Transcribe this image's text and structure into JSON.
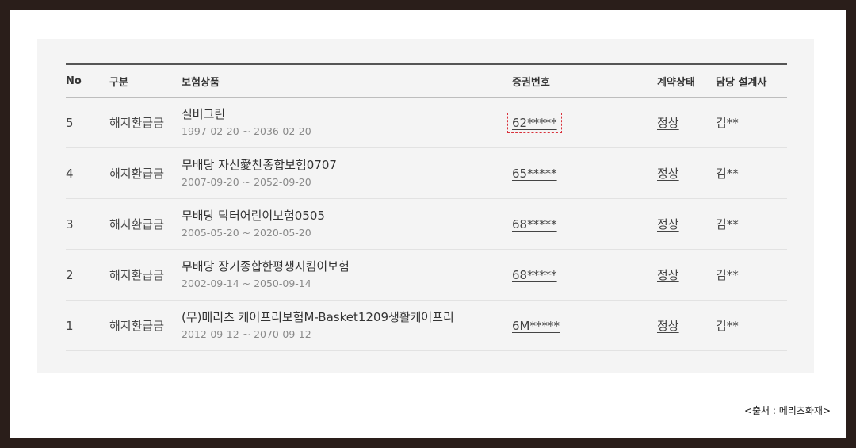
{
  "table": {
    "headers": {
      "no": "No",
      "type": "구분",
      "product": "보험상품",
      "policy_number": "증권번호",
      "status": "계약상태",
      "planner": "담당 설계사"
    },
    "rows": [
      {
        "no": "5",
        "type": "해지환급금",
        "product_name": "실버그린",
        "period": "1997-02-20 ~ 2036-02-20",
        "policy_number": "62*****",
        "status": "정상",
        "planner": "김**",
        "focused": true
      },
      {
        "no": "4",
        "type": "해지환급금",
        "product_name": "무배당 자신愛찬종합보험0707",
        "period": "2007-09-20 ~ 2052-09-20",
        "policy_number": "65*****",
        "status": "정상",
        "planner": "김**",
        "focused": false
      },
      {
        "no": "3",
        "type": "해지환급금",
        "product_name": "무배당 닥터어린이보험0505",
        "period": "2005-05-20 ~ 2020-05-20",
        "policy_number": "68*****",
        "status": "정상",
        "planner": "김**",
        "focused": false
      },
      {
        "no": "2",
        "type": "해지환급금",
        "product_name": "무배당 장기종합한평생지킴이보험",
        "period": "2002-09-14 ~ 2050-09-14",
        "policy_number": "68*****",
        "status": "정상",
        "planner": "김**",
        "focused": false
      },
      {
        "no": "1",
        "type": "해지환급금",
        "product_name": "(무)메리츠 케어프리보험M-Basket1209생활케어프리",
        "period": "2012-09-12 ~ 2070-09-12",
        "policy_number": "6M*****",
        "status": "정상",
        "planner": "김**",
        "focused": false
      }
    ]
  },
  "source_caption": "<출처 : 메리츠화재>",
  "colors": {
    "outer_border": "#2a1e1a",
    "panel_background": "#f4f4f4",
    "focus_outline": "#d9303a"
  }
}
